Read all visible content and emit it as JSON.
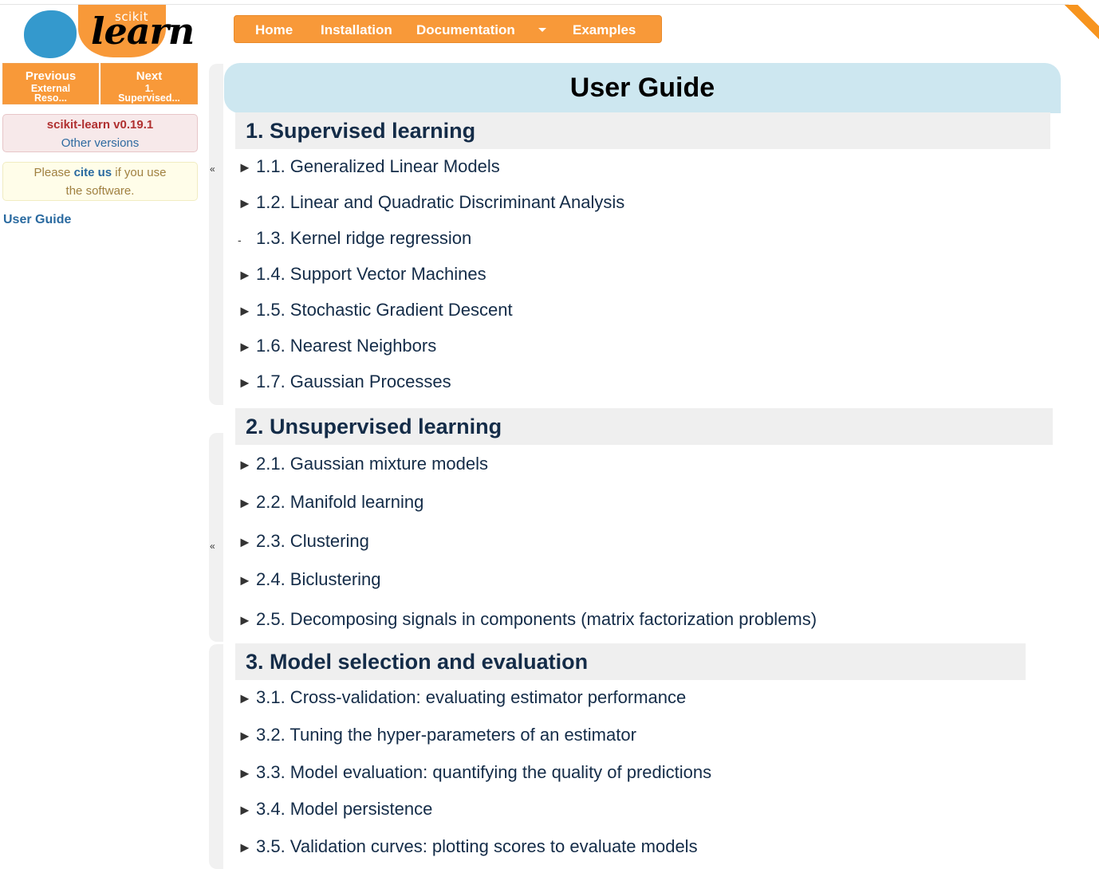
{
  "logo": {
    "small_text": "scikit",
    "big_text": "learn"
  },
  "nav": {
    "items": [
      {
        "label": "Home"
      },
      {
        "label": "Installation"
      },
      {
        "label": "Documentation"
      },
      {
        "label": "Examples"
      }
    ]
  },
  "related": {
    "prev": {
      "title": "Previous",
      "line1": "External",
      "line2": "Reso..."
    },
    "next": {
      "title": "Next",
      "line1": "1.",
      "line2": "Supervised..."
    }
  },
  "version": {
    "label": "scikit-learn v0.19.1",
    "other": "Other versions"
  },
  "cite": {
    "before": "Please ",
    "link": "cite us",
    "after": " if you use",
    "line2": "the software."
  },
  "sidebar": {
    "user_guide": "User Guide"
  },
  "collapse_symbol": "«",
  "page": {
    "title": "User Guide"
  },
  "sections": [
    {
      "title": "1. Supervised learning",
      "items": [
        {
          "bullet": "►",
          "label": "1.1. Generalized Linear Models"
        },
        {
          "bullet": "►",
          "label": "1.2. Linear and Quadratic Discriminant Analysis"
        },
        {
          "bullet": "-",
          "label": "1.3. Kernel ridge regression"
        },
        {
          "bullet": "►",
          "label": "1.4. Support Vector Machines"
        },
        {
          "bullet": "►",
          "label": "1.5. Stochastic Gradient Descent"
        },
        {
          "bullet": "►",
          "label": "1.6. Nearest Neighbors"
        },
        {
          "bullet": "►",
          "label": "1.7. Gaussian Processes"
        }
      ]
    },
    {
      "title": "2. Unsupervised learning",
      "items": [
        {
          "bullet": "►",
          "label": "2.1. Gaussian mixture models"
        },
        {
          "bullet": "►",
          "label": "2.2. Manifold learning"
        },
        {
          "bullet": "►",
          "label": "2.3. Clustering"
        },
        {
          "bullet": "►",
          "label": "2.4. Biclustering"
        },
        {
          "bullet": "►",
          "label": "2.5. Decomposing signals in components (matrix factorization problems)"
        }
      ]
    },
    {
      "title": "3. Model selection and evaluation",
      "items": [
        {
          "bullet": "►",
          "label": "3.1. Cross-validation: evaluating estimator performance"
        },
        {
          "bullet": "►",
          "label": "3.2. Tuning the hyper-parameters of an estimator"
        },
        {
          "bullet": "►",
          "label": "3.3. Model evaluation: quantifying the quality of predictions"
        },
        {
          "bullet": "►",
          "label": "3.4. Model persistence"
        },
        {
          "bullet": "►",
          "label": "3.5. Validation curves: plotting scores to evaluate models"
        }
      ]
    }
  ]
}
